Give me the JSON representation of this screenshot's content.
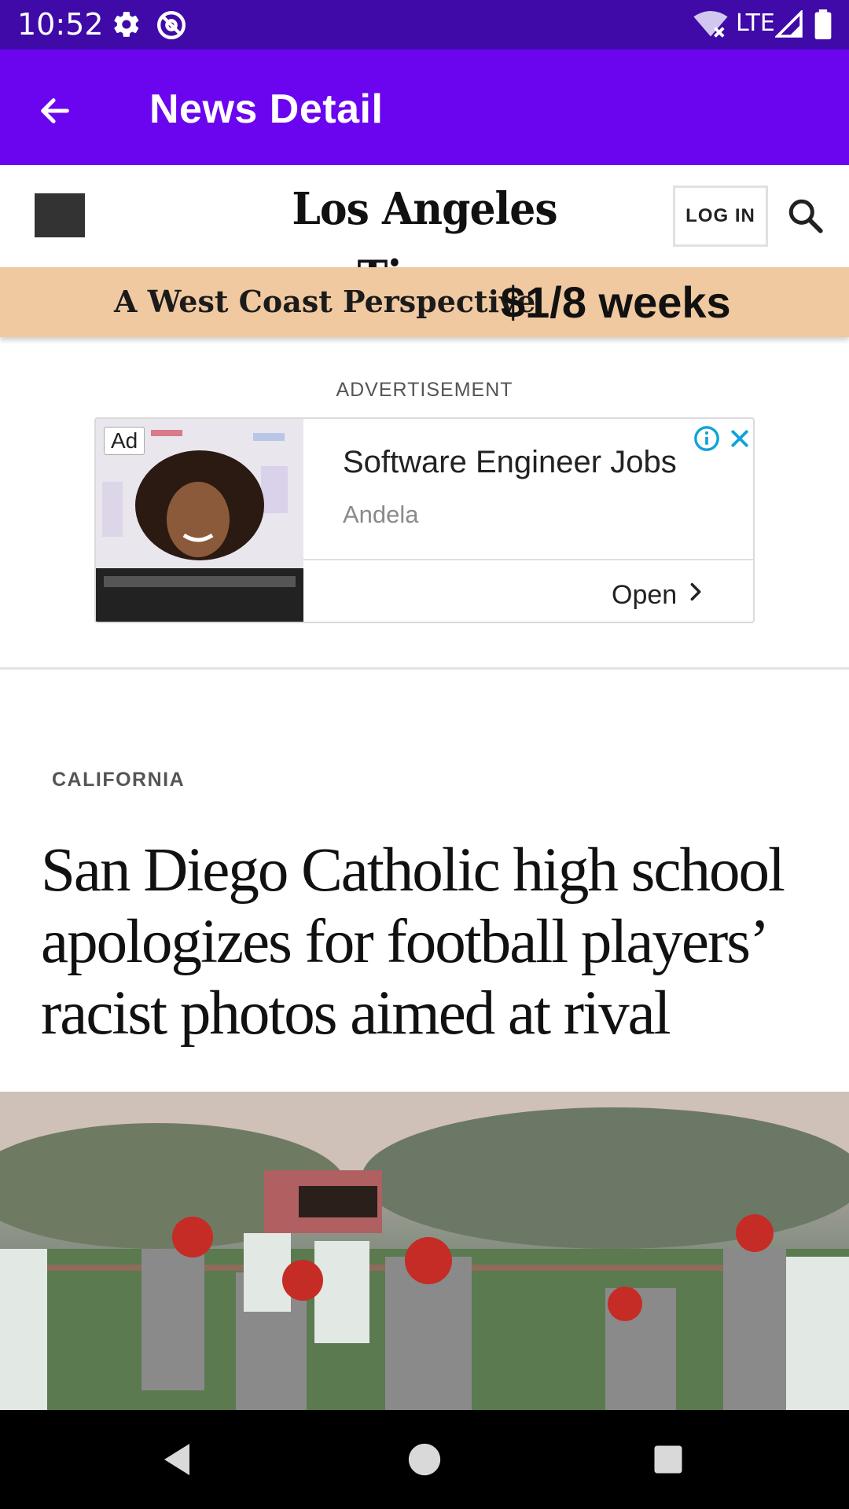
{
  "status_bar": {
    "time": "10:52",
    "network": "LTE",
    "icons": [
      "settings-icon",
      "at-sign-icon",
      "wifi-off-icon",
      "signal-icon",
      "battery-icon"
    ]
  },
  "app_bar": {
    "title": "News Detail",
    "back_icon": "arrow-left-icon",
    "background": "#6b05f0"
  },
  "site_header": {
    "logo_text": "Los Angeles Times",
    "login_label": "LOG IN",
    "menu_icon": "hamburger-icon",
    "search_icon": "search-icon"
  },
  "promo": {
    "tagline": "A West Coast Perspective",
    "offer": "$1/8 weeks",
    "background": "#f0c9a0"
  },
  "advertisement": {
    "label": "ADVERTISEMENT",
    "badge": "Ad",
    "title": "Software Engineer Jobs",
    "sponsor": "Andela",
    "cta": "Open"
  },
  "article": {
    "section": "CALIFORNIA",
    "headline": "San Diego Catholic high school apologizes for football players’ racist photos aimed at rival"
  },
  "nav_bar": {
    "icons": [
      "back-triangle-icon",
      "home-circle-icon",
      "recents-square-icon"
    ]
  }
}
